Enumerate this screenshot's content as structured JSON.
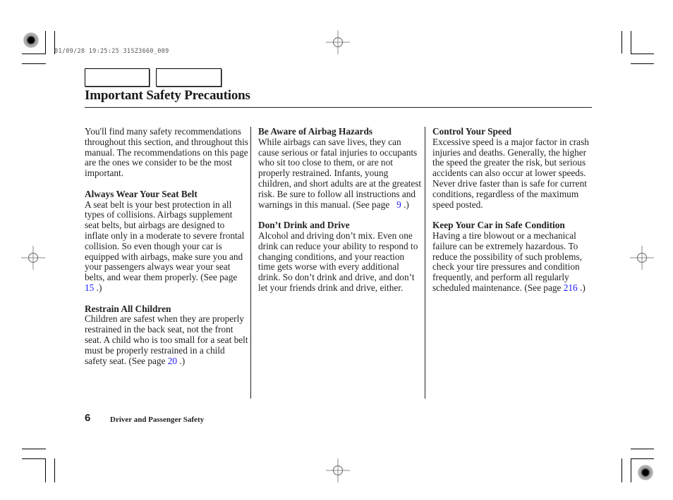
{
  "print_meta": {
    "timestamp": "01/09/28 19:25:25 31SZ3660_009"
  },
  "header": {
    "nav_boxes": [
      "",
      ""
    ],
    "title": "Important Safety Precautions"
  },
  "columns": [
    {
      "sections": [
        {
          "heading": "",
          "text": "You'll find many safety recommendations throughout this section, and throughout this manual. The recommendations on this page are the ones we consider to be the most important.",
          "ref_prefix": "",
          "ref_page": "",
          "ref_suffix": ""
        },
        {
          "heading": "Always Wear Your Seat Belt",
          "text": "A seat belt is your best protection in all types of collisions. Airbags supplement seat belts, but airbags are designed to inflate only in a moderate to severe frontal collision. So even though your car is equipped with airbags, make sure you and your passengers always wear your seat belts, and wear them properly.",
          "ref_prefix": " (See page ",
          "ref_page": "15",
          "ref_suffix": " .)"
        },
        {
          "heading": "Restrain All Children",
          "text": "Children are safest when they are properly restrained in the back seat, not the front seat. A child who is too small for a seat belt must be properly restrained in a child safety seat.",
          "ref_prefix": " (See page ",
          "ref_page": "20",
          "ref_suffix": " .)"
        }
      ]
    },
    {
      "sections": [
        {
          "heading": "Be Aware of Airbag Hazards",
          "text": "While airbags can save lives, they can cause serious or fatal injuries to occupants who sit too close to them, or are not properly restrained. Infants, young children, and short adults are at the greatest risk. Be sure to follow all instructions and warnings in this manual.",
          "ref_prefix": " (See page   ",
          "ref_page": "9",
          "ref_suffix": " .)"
        },
        {
          "heading": "Don’t Drink and Drive",
          "text": "Alcohol and driving don’t mix. Even one drink can reduce your ability to respond to changing conditions, and your reaction time gets worse with every additional drink. So don’t drink and drive, and don’t let your friends drink and drive, either.",
          "ref_prefix": "",
          "ref_page": "",
          "ref_suffix": ""
        }
      ]
    },
    {
      "sections": [
        {
          "heading": "Control Your Speed",
          "text": "Excessive speed is a major factor in crash injuries and deaths. Generally, the higher the speed the greater the risk, but serious accidents can also occur at lower speeds. Never drive faster than is safe for current conditions, regardless of the maximum speed posted.",
          "ref_prefix": "",
          "ref_page": "",
          "ref_suffix": ""
        },
        {
          "heading": "Keep Your Car in Safe Condition",
          "text": "Having a tire blowout or a mechanical failure can be extremely hazardous. To reduce the possibility of such problems, check your tire pressures and condition frequently, and perform all regularly scheduled maintenance.",
          "ref_prefix": " (See page ",
          "ref_page": "216",
          "ref_suffix": " .)"
        }
      ]
    }
  ],
  "footer": {
    "page_number": "6",
    "section_name": "Driver and Passenger Safety"
  },
  "colors": {
    "link": "#1a1aff",
    "text": "#222222",
    "rule": "#222222"
  },
  "icons": {
    "registration_target": "registration-target-icon",
    "crosshair": "crosshair-icon"
  }
}
